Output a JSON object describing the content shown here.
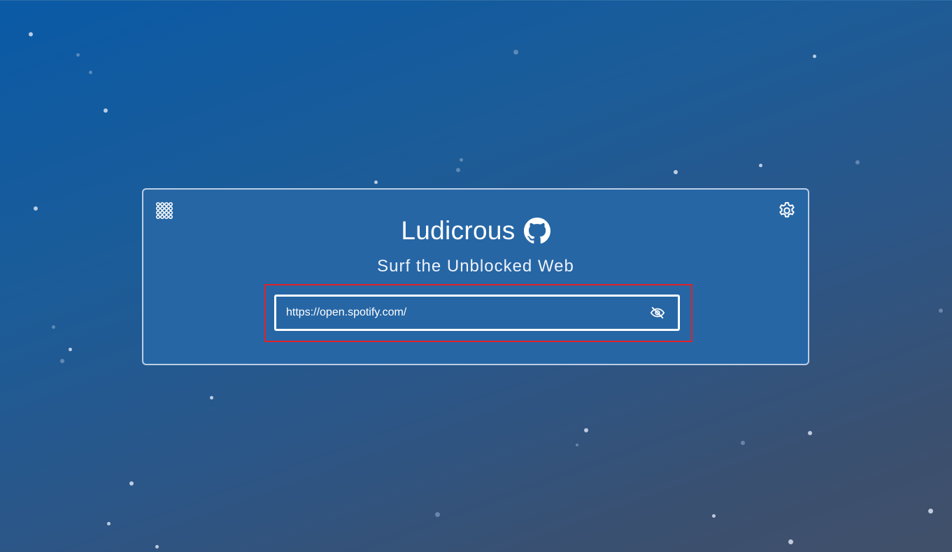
{
  "app": {
    "title": "Ludicrous",
    "subtitle": "Surf the Unblocked Web"
  },
  "url_bar": {
    "value": "https://open.spotify.com/",
    "placeholder": ""
  },
  "icons": {
    "apps": "apps-grid-icon",
    "settings": "gear-icon",
    "github": "github-icon",
    "visibility": "eye-off-icon"
  },
  "colors": {
    "accent_outline": "#e0212a",
    "card_background": "#2666a5",
    "text": "#ffffff"
  }
}
